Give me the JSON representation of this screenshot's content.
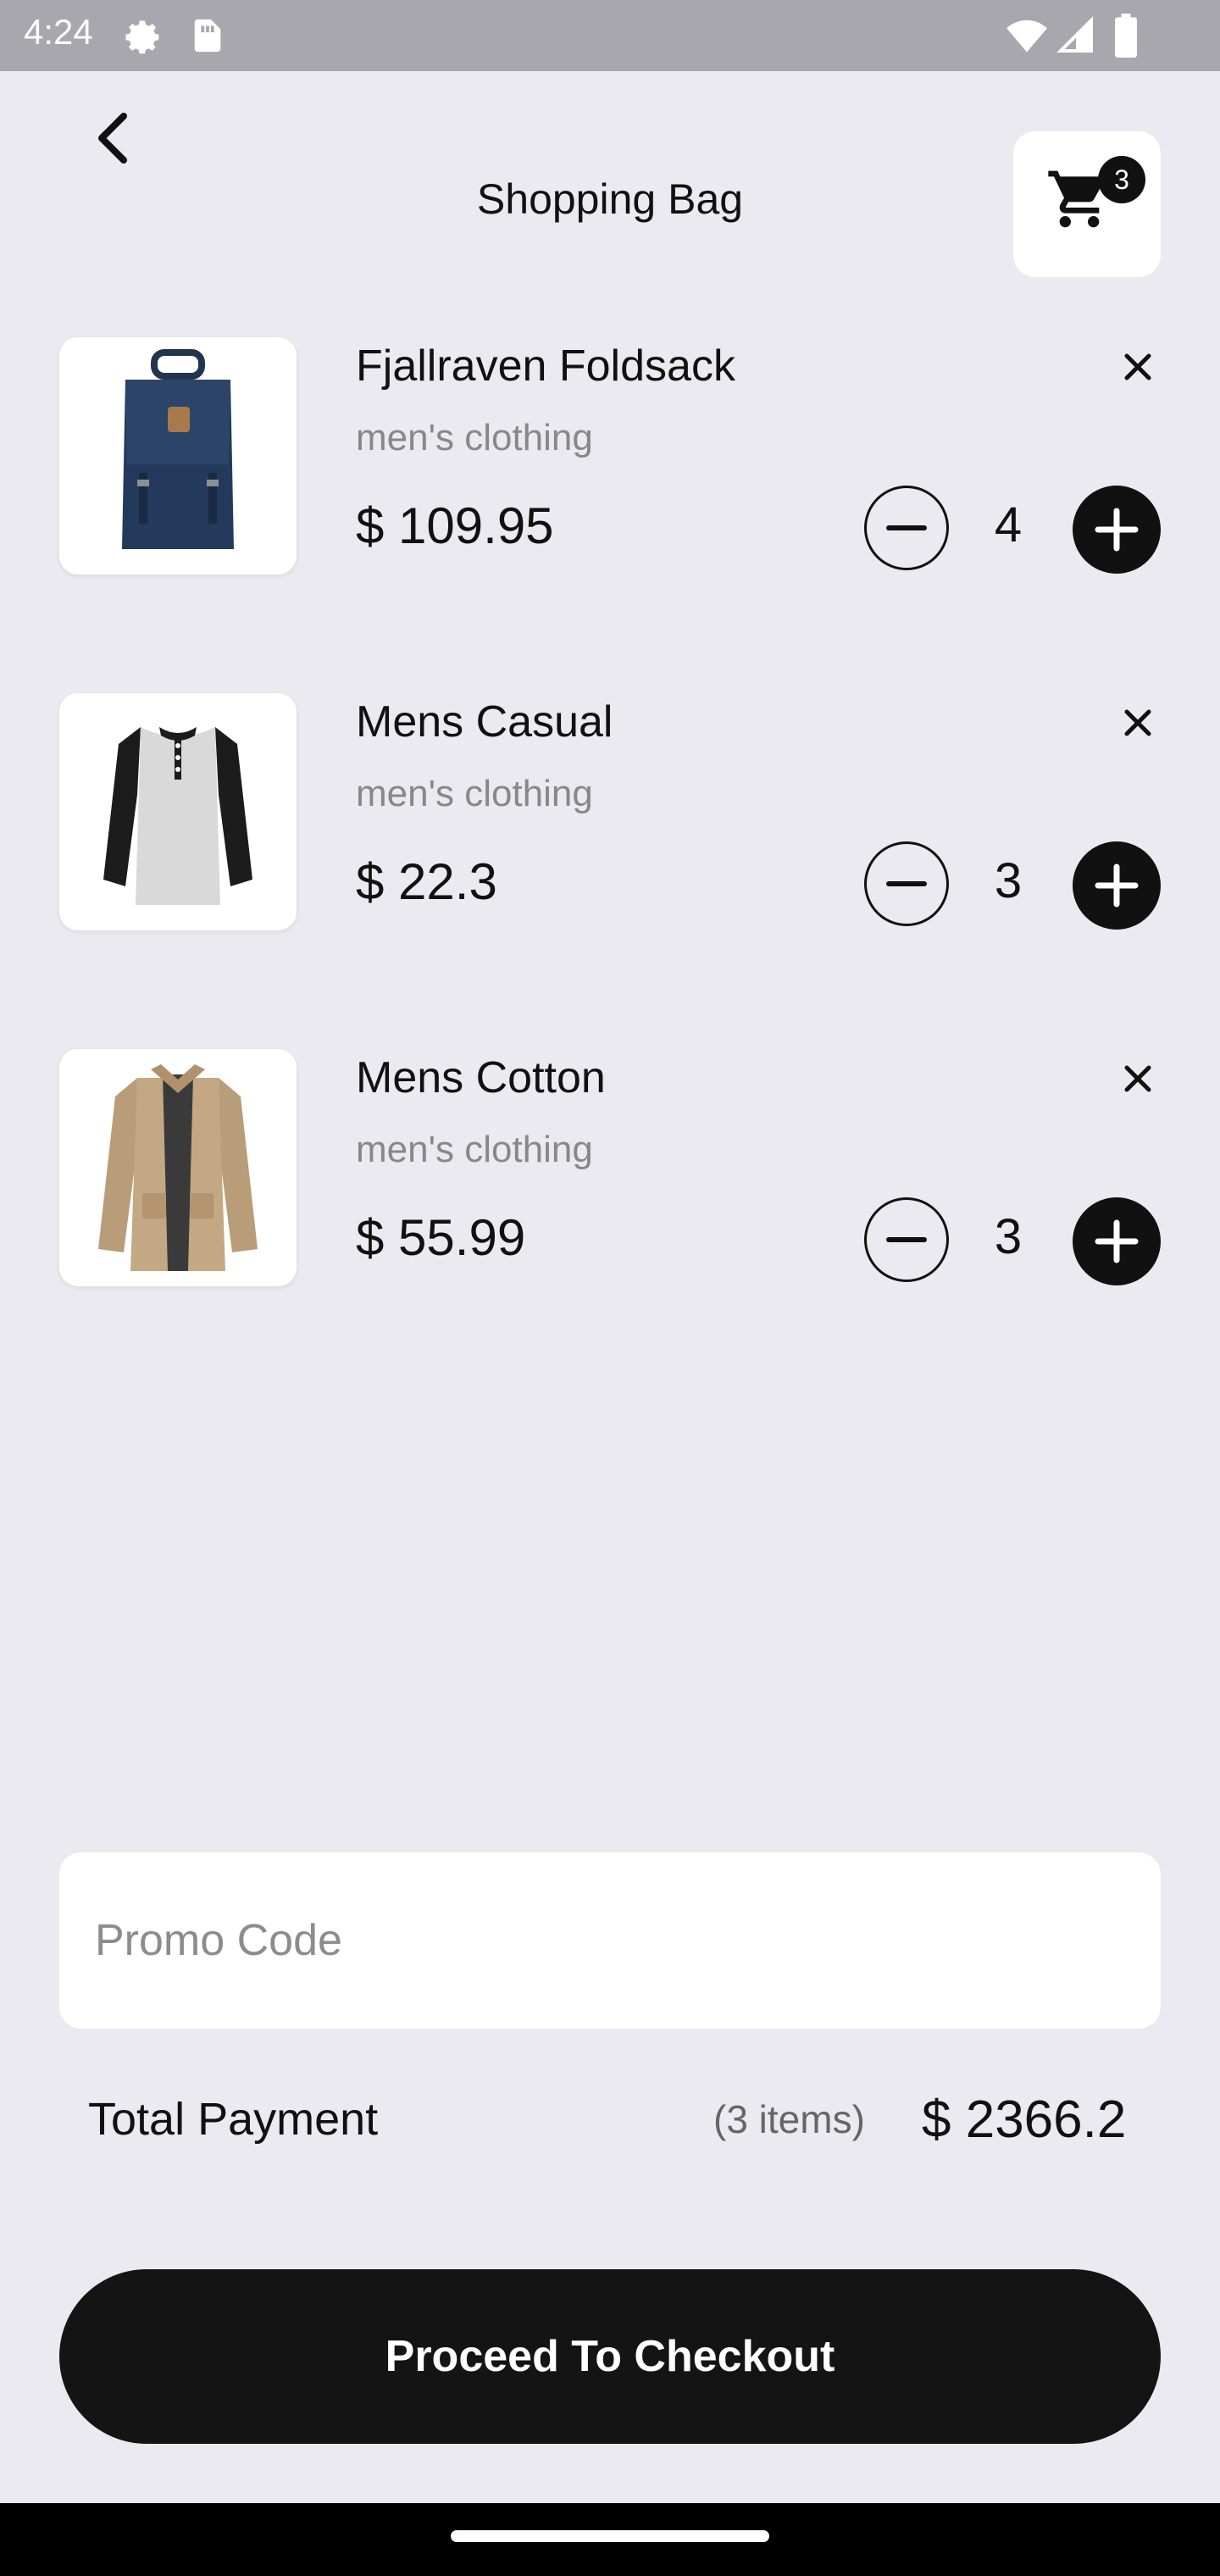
{
  "status_bar": {
    "time": "4:24",
    "icons": [
      "settings-gear-icon",
      "sim-card-icon",
      "wifi-icon",
      "signal-icon",
      "battery-icon"
    ]
  },
  "header": {
    "title": "Shopping Bag",
    "cart_count": "3",
    "back_icon": "chevron-left-icon",
    "cart_icon": "shopping-cart-icon"
  },
  "items": [
    {
      "name": "Fjallraven Foldsack",
      "category": "men's clothing",
      "price": "$ 109.95",
      "quantity": "4",
      "image": "backpack"
    },
    {
      "name": "Mens Casual",
      "category": "men's clothing",
      "price": "$ 22.3",
      "quantity": "3",
      "image": "raglan-tshirt"
    },
    {
      "name": "Mens Cotton",
      "category": "men's clothing",
      "price": "$ 55.99",
      "quantity": "3",
      "image": "cotton-jacket"
    }
  ],
  "promo": {
    "placeholder": "Promo Code",
    "value": ""
  },
  "total": {
    "label": "Total Payment",
    "count": "(3 items)",
    "amount": "$ 2366.2"
  },
  "checkout": {
    "label": "Proceed To Checkout"
  },
  "colors": {
    "background": "#ebeaf0",
    "accent": "#111111",
    "card": "#ffffff",
    "muted": "#888888"
  }
}
